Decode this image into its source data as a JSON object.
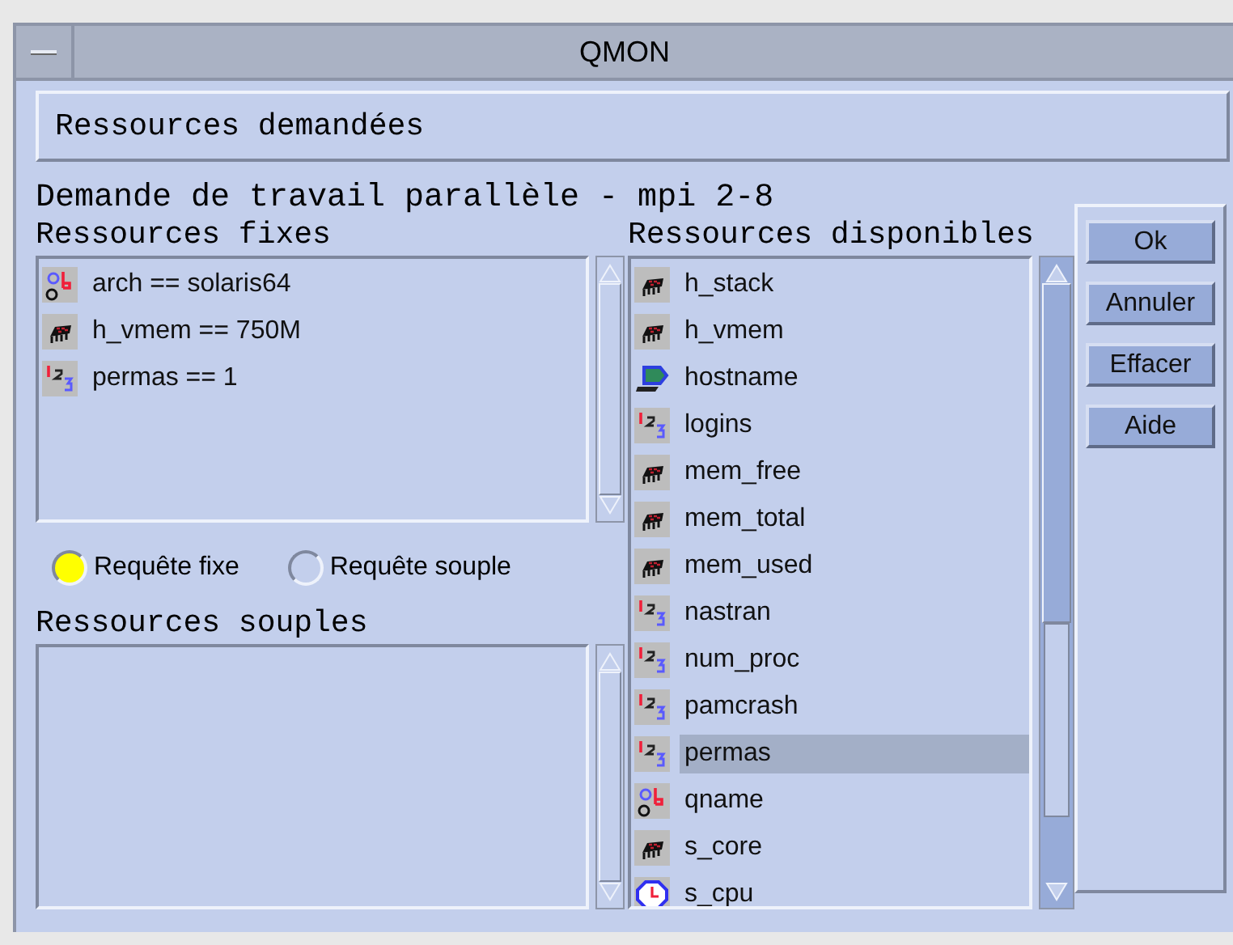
{
  "window": {
    "title": "QMON"
  },
  "header": "Ressources demandées",
  "request_title": "Demande de travail parallèle - mpi 2-8",
  "fixed": {
    "label": "Ressources fixes",
    "items": [
      {
        "kind": "string",
        "text": "arch == solaris64"
      },
      {
        "kind": "memory",
        "text": "h_vmem == 750M"
      },
      {
        "kind": "int",
        "text": "permas == 1"
      }
    ]
  },
  "request_type": [
    {
      "label": "Requête fixe",
      "selected": true
    },
    {
      "label": "Requête souple",
      "selected": false
    }
  ],
  "soft": {
    "label": "Ressources souples"
  },
  "available": {
    "label": "Ressources disponibles",
    "items": [
      {
        "kind": "memory",
        "text": "h_stack",
        "selected": false
      },
      {
        "kind": "memory",
        "text": "h_vmem",
        "selected": false
      },
      {
        "kind": "host",
        "text": "hostname",
        "selected": false
      },
      {
        "kind": "int",
        "text": "logins",
        "selected": false
      },
      {
        "kind": "memory",
        "text": "mem_free",
        "selected": false
      },
      {
        "kind": "memory",
        "text": "mem_total",
        "selected": false
      },
      {
        "kind": "memory",
        "text": "mem_used",
        "selected": false
      },
      {
        "kind": "int",
        "text": "nastran",
        "selected": false
      },
      {
        "kind": "int",
        "text": "num_proc",
        "selected": false
      },
      {
        "kind": "int",
        "text": "pamcrash",
        "selected": false
      },
      {
        "kind": "int",
        "text": "permas",
        "selected": true
      },
      {
        "kind": "string",
        "text": "qname",
        "selected": false
      },
      {
        "kind": "memory",
        "text": "s_core",
        "selected": false
      },
      {
        "kind": "time",
        "text": "s_cpu",
        "selected": false
      }
    ]
  },
  "buttons": [
    "Ok",
    "Annuler",
    "Effacer",
    "Aide"
  ]
}
